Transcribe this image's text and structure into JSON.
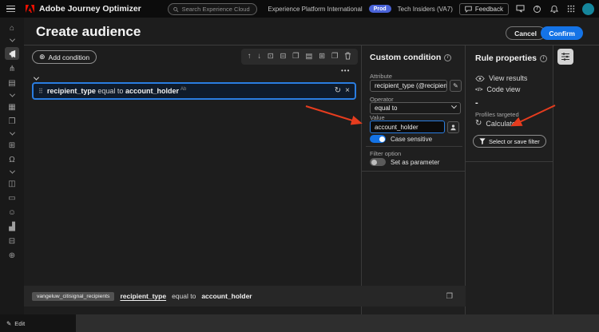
{
  "topbar": {
    "app_title": "Adobe Journey Optimizer",
    "search_placeholder": "Search Experience Cloud (⌘+/)",
    "org": "Experience Platform International",
    "env_badge": "Prod",
    "sandbox": "Tech Insiders (VA7)",
    "feedback_label": "Feedback"
  },
  "header": {
    "title": "Create audience",
    "cancel_label": "Cancel",
    "confirm_label": "Confirm"
  },
  "toolbar": {
    "add_condition_label": "Add condition",
    "plus_glyph": "⊕",
    "icons": [
      "↑",
      "↓",
      "⊡",
      "⊟",
      "❐",
      "▤",
      "⊞",
      "❐"
    ]
  },
  "condition": {
    "attribute": "recipient_type",
    "operator": "equal to",
    "value": "account_holder",
    "type_hint": "Ab",
    "drag_glyph": "⠿",
    "refresh_glyph": "↻",
    "close_glyph": "×",
    "more_glyph": "•••"
  },
  "custom_condition_panel": {
    "title": "Custom condition",
    "attribute_label": "Attribute",
    "attribute_value": "recipient_type (@recipient_type)",
    "operator_label": "Operator",
    "operator_value": "equal to",
    "value_label": "Value",
    "value_value": "account_holder",
    "case_sensitive_label": "Case sensitive",
    "filter_option_label": "Filter option",
    "set_as_parameter_label": "Set as parameter",
    "edit_attr_glyph": "✎"
  },
  "rule_properties_panel": {
    "title": "Rule properties",
    "view_results_label": "View results",
    "code_view_label": "Code view",
    "code_glyph": "</>",
    "profiles_count": "-",
    "profiles_targeted_label": "Profiles targeted",
    "calculate_label": "Calculate",
    "calculate_glyph": "↻",
    "filter_button_label": "Select or save filter"
  },
  "summary_bar": {
    "tag": "vangeluw_citisignal_recipients",
    "attribute": "recipient_type",
    "operator": "equal to",
    "value": "account_holder",
    "copy_glyph": "❐"
  },
  "footer": {
    "edit_label": "Edit",
    "pencil_glyph": "✎"
  },
  "sidebar": {
    "icons": [
      {
        "name": "home-icon",
        "glyph": "⌂"
      },
      {
        "name": "chevron-down-icon",
        "glyph": ""
      },
      {
        "name": "megaphone-icon",
        "glyph": ""
      },
      {
        "name": "flow-icon",
        "glyph": "⋔"
      },
      {
        "name": "document-icon",
        "glyph": "▤"
      },
      {
        "name": "chevron-down-icon",
        "glyph": ""
      },
      {
        "name": "dataset-icon",
        "glyph": "▦"
      },
      {
        "name": "copy-icon",
        "glyph": "❐"
      },
      {
        "name": "chevron-down-icon",
        "glyph": ""
      },
      {
        "name": "table-icon",
        "glyph": "⊞"
      },
      {
        "name": "bell-icon",
        "glyph": "Ω"
      },
      {
        "name": "chevron-down-icon",
        "glyph": ""
      },
      {
        "name": "card-icon",
        "glyph": "◫"
      },
      {
        "name": "panel-icon",
        "glyph": "▭"
      },
      {
        "name": "face-icon",
        "glyph": "☺"
      },
      {
        "name": "chart-icon",
        "glyph": "▟"
      },
      {
        "name": "wallet-icon",
        "glyph": "⊟"
      },
      {
        "name": "globe-icon",
        "glyph": "⊕"
      }
    ]
  },
  "colors": {
    "accent_blue": "#1473e6",
    "selection_border": "#2a7de1",
    "annotation_arrow": "#e63c1e",
    "env_badge": "#4a63d8",
    "avatar": "#15869c",
    "topbar_bg": "#0c0c0c",
    "app_bg": "#1d1d1d"
  }
}
